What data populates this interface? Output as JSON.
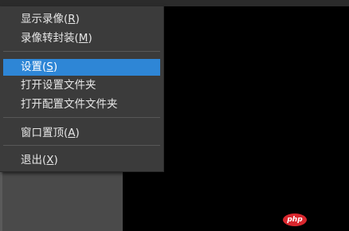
{
  "menu": {
    "items": [
      {
        "pre": "显示录像(",
        "key": "R",
        "post": ")"
      },
      {
        "pre": "录像转封装(",
        "key": "M",
        "post": ")"
      },
      {
        "pre": "设置(",
        "key": "S",
        "post": ")"
      },
      {
        "pre": "打开设置文件夹",
        "key": "",
        "post": ""
      },
      {
        "pre": "打开配置文件文件夹",
        "key": "",
        "post": ""
      },
      {
        "pre": "窗口置顶(",
        "key": "A",
        "post": ")"
      },
      {
        "pre": "退出(",
        "key": "X",
        "post": ")"
      }
    ],
    "selected": "设置(S)"
  },
  "watermark": {
    "text": "php",
    "color": "#d9272e"
  },
  "colors": {
    "menu_bg": "#3b3b3b",
    "selected_bg": "#2e86d6",
    "panel_bg": "#4a4a4a",
    "canvas_bg": "#000000"
  }
}
